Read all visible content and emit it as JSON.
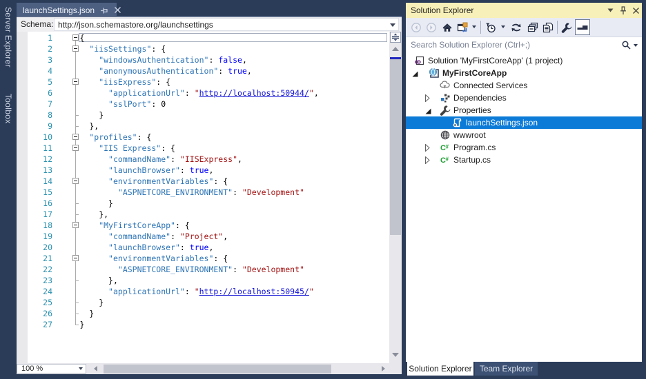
{
  "colors": {
    "window_background": "#2B3C59",
    "doc_tab_background": "#4D6082",
    "editor_background": "#FFFFFF",
    "line_number": "#2B91AF",
    "json_key": "#2E75B6",
    "json_string": "#A31515",
    "json_keyword": "#0000FF",
    "json_url_link": "#0F0FD6",
    "tree_selection": "#0C7BD8",
    "panel_title_background": "#F7F0B8"
  },
  "left_dock": {
    "tabs": [
      {
        "label": "Server Explorer"
      },
      {
        "label": "Toolbox"
      }
    ]
  },
  "editor": {
    "tab": {
      "title": "launchSettings.json",
      "icons": [
        "pin-icon",
        "close-icon"
      ]
    },
    "schema_bar": {
      "label": "Schema:",
      "value": "http://json.schemastore.org/launchsettings"
    },
    "zoom_control": {
      "value": "100 %"
    },
    "code": {
      "language": "JSON",
      "current_line": 1,
      "lines": [
        {
          "n": 1,
          "fold": "open",
          "tokens": [
            [
              "p",
              "{"
            ]
          ]
        },
        {
          "n": 2,
          "fold": "open",
          "tokens": [
            [
              "p",
              "  "
            ],
            [
              "k",
              "\"iisSettings\""
            ],
            [
              "p",
              ": {"
            ]
          ]
        },
        {
          "n": 3,
          "tokens": [
            [
              "p",
              "    "
            ],
            [
              "k",
              "\"windowsAuthentication\""
            ],
            [
              "p",
              ": "
            ],
            [
              "b",
              "false"
            ],
            [
              "p",
              ","
            ]
          ]
        },
        {
          "n": 4,
          "tokens": [
            [
              "p",
              "    "
            ],
            [
              "k",
              "\"anonymousAuthentication\""
            ],
            [
              "p",
              ": "
            ],
            [
              "b",
              "true"
            ],
            [
              "p",
              ","
            ]
          ]
        },
        {
          "n": 5,
          "fold": "open",
          "tokens": [
            [
              "p",
              "    "
            ],
            [
              "k",
              "\"iisExpress\""
            ],
            [
              "p",
              ": {"
            ]
          ]
        },
        {
          "n": 6,
          "tokens": [
            [
              "p",
              "      "
            ],
            [
              "k",
              "\"applicationUrl\""
            ],
            [
              "p",
              ": "
            ],
            [
              "s",
              "\""
            ],
            [
              "u",
              "http://localhost:50944/"
            ],
            [
              "s",
              "\""
            ],
            [
              "p",
              ","
            ]
          ]
        },
        {
          "n": 7,
          "tokens": [
            [
              "p",
              "      "
            ],
            [
              "k",
              "\"sslPort\""
            ],
            [
              "p",
              ": "
            ],
            [
              "n",
              "0"
            ]
          ]
        },
        {
          "n": 8,
          "fold": "end",
          "tokens": [
            [
              "p",
              "    }"
            ]
          ]
        },
        {
          "n": 9,
          "fold": "end",
          "tokens": [
            [
              "p",
              "  },"
            ]
          ]
        },
        {
          "n": 10,
          "fold": "open",
          "tokens": [
            [
              "p",
              "  "
            ],
            [
              "k",
              "\"profiles\""
            ],
            [
              "p",
              ": {"
            ]
          ]
        },
        {
          "n": 11,
          "fold": "open",
          "tokens": [
            [
              "p",
              "    "
            ],
            [
              "k",
              "\"IIS Express\""
            ],
            [
              "p",
              ": {"
            ]
          ]
        },
        {
          "n": 12,
          "tokens": [
            [
              "p",
              "      "
            ],
            [
              "k",
              "\"commandName\""
            ],
            [
              "p",
              ": "
            ],
            [
              "s",
              "\"IISExpress\""
            ],
            [
              "p",
              ","
            ]
          ]
        },
        {
          "n": 13,
          "tokens": [
            [
              "p",
              "      "
            ],
            [
              "k",
              "\"launchBrowser\""
            ],
            [
              "p",
              ": "
            ],
            [
              "b",
              "true"
            ],
            [
              "p",
              ","
            ]
          ]
        },
        {
          "n": 14,
          "fold": "open",
          "tokens": [
            [
              "p",
              "      "
            ],
            [
              "k",
              "\"environmentVariables\""
            ],
            [
              "p",
              ": {"
            ]
          ]
        },
        {
          "n": 15,
          "tokens": [
            [
              "p",
              "        "
            ],
            [
              "k",
              "\"ASPNETCORE_ENVIRONMENT\""
            ],
            [
              "p",
              ": "
            ],
            [
              "s",
              "\"Development\""
            ]
          ]
        },
        {
          "n": 16,
          "fold": "end",
          "tokens": [
            [
              "p",
              "      }"
            ]
          ]
        },
        {
          "n": 17,
          "fold": "end",
          "tokens": [
            [
              "p",
              "    },"
            ]
          ]
        },
        {
          "n": 18,
          "fold": "open",
          "tokens": [
            [
              "p",
              "    "
            ],
            [
              "k",
              "\"MyFirstCoreApp\""
            ],
            [
              "p",
              ": {"
            ]
          ]
        },
        {
          "n": 19,
          "tokens": [
            [
              "p",
              "      "
            ],
            [
              "k",
              "\"commandName\""
            ],
            [
              "p",
              ": "
            ],
            [
              "s",
              "\"Project\""
            ],
            [
              "p",
              ","
            ]
          ]
        },
        {
          "n": 20,
          "tokens": [
            [
              "p",
              "      "
            ],
            [
              "k",
              "\"launchBrowser\""
            ],
            [
              "p",
              ": "
            ],
            [
              "b",
              "true"
            ],
            [
              "p",
              ","
            ]
          ]
        },
        {
          "n": 21,
          "fold": "open",
          "tokens": [
            [
              "p",
              "      "
            ],
            [
              "k",
              "\"environmentVariables\""
            ],
            [
              "p",
              ": {"
            ]
          ]
        },
        {
          "n": 22,
          "tokens": [
            [
              "p",
              "        "
            ],
            [
              "k",
              "\"ASPNETCORE_ENVIRONMENT\""
            ],
            [
              "p",
              ": "
            ],
            [
              "s",
              "\"Development\""
            ]
          ]
        },
        {
          "n": 23,
          "fold": "end",
          "tokens": [
            [
              "p",
              "      },"
            ]
          ]
        },
        {
          "n": 24,
          "tokens": [
            [
              "p",
              "      "
            ],
            [
              "k",
              "\"applicationUrl\""
            ],
            [
              "p",
              ": "
            ],
            [
              "s",
              "\""
            ],
            [
              "u",
              "http://localhost:50945/"
            ],
            [
              "s",
              "\""
            ]
          ]
        },
        {
          "n": 25,
          "fold": "end",
          "tokens": [
            [
              "p",
              "    }"
            ]
          ]
        },
        {
          "n": 26,
          "fold": "end",
          "tokens": [
            [
              "p",
              "  }"
            ]
          ]
        },
        {
          "n": 27,
          "fold": "end",
          "tokens": [
            [
              "p",
              "}"
            ]
          ]
        }
      ]
    }
  },
  "solution_explorer": {
    "title": "Solution Explorer",
    "title_icons": [
      "window-position-icon",
      "pin-icon",
      "close-icon"
    ],
    "toolbar_icons": [
      "back-icon",
      "forward-icon",
      "home-icon",
      "switch-views-icon",
      "pending-changes-filter-icon",
      "sync-with-active-document-icon",
      "collapse-all-icon",
      "show-all-files-icon",
      "properties-icon",
      "preview-selected-items-icon"
    ],
    "search": {
      "placeholder": "Search Solution Explorer (Ctrl+;)",
      "icons": [
        "search-icon",
        "search-options-icon"
      ]
    },
    "tree": [
      {
        "label": "Solution 'MyFirstCoreApp' (1 project)",
        "icon": "solution",
        "indent": 0
      },
      {
        "label": "MyFirstCoreApp",
        "icon": "webproject",
        "indent": 1,
        "expander": "expanded",
        "bold": true
      },
      {
        "label": "Connected Services",
        "icon": "connectedservices",
        "indent": 2
      },
      {
        "label": "Dependencies",
        "icon": "dependencies",
        "indent": 2,
        "expander": "collapsed"
      },
      {
        "label": "Properties",
        "icon": "wrench",
        "indent": 2,
        "expander": "expanded"
      },
      {
        "label": "launchSettings.json",
        "icon": "jsonfile",
        "indent": 3,
        "selected": true
      },
      {
        "label": "wwwroot",
        "icon": "globe",
        "indent": 2
      },
      {
        "label": "Program.cs",
        "icon": "csharp",
        "indent": 2,
        "expander": "collapsed"
      },
      {
        "label": "Startup.cs",
        "icon": "csharp",
        "indent": 2,
        "expander": "collapsed"
      }
    ],
    "bottom_tabs": [
      {
        "label": "Solution Explorer",
        "active": true
      },
      {
        "label": "Team Explorer",
        "active": false
      }
    ]
  }
}
